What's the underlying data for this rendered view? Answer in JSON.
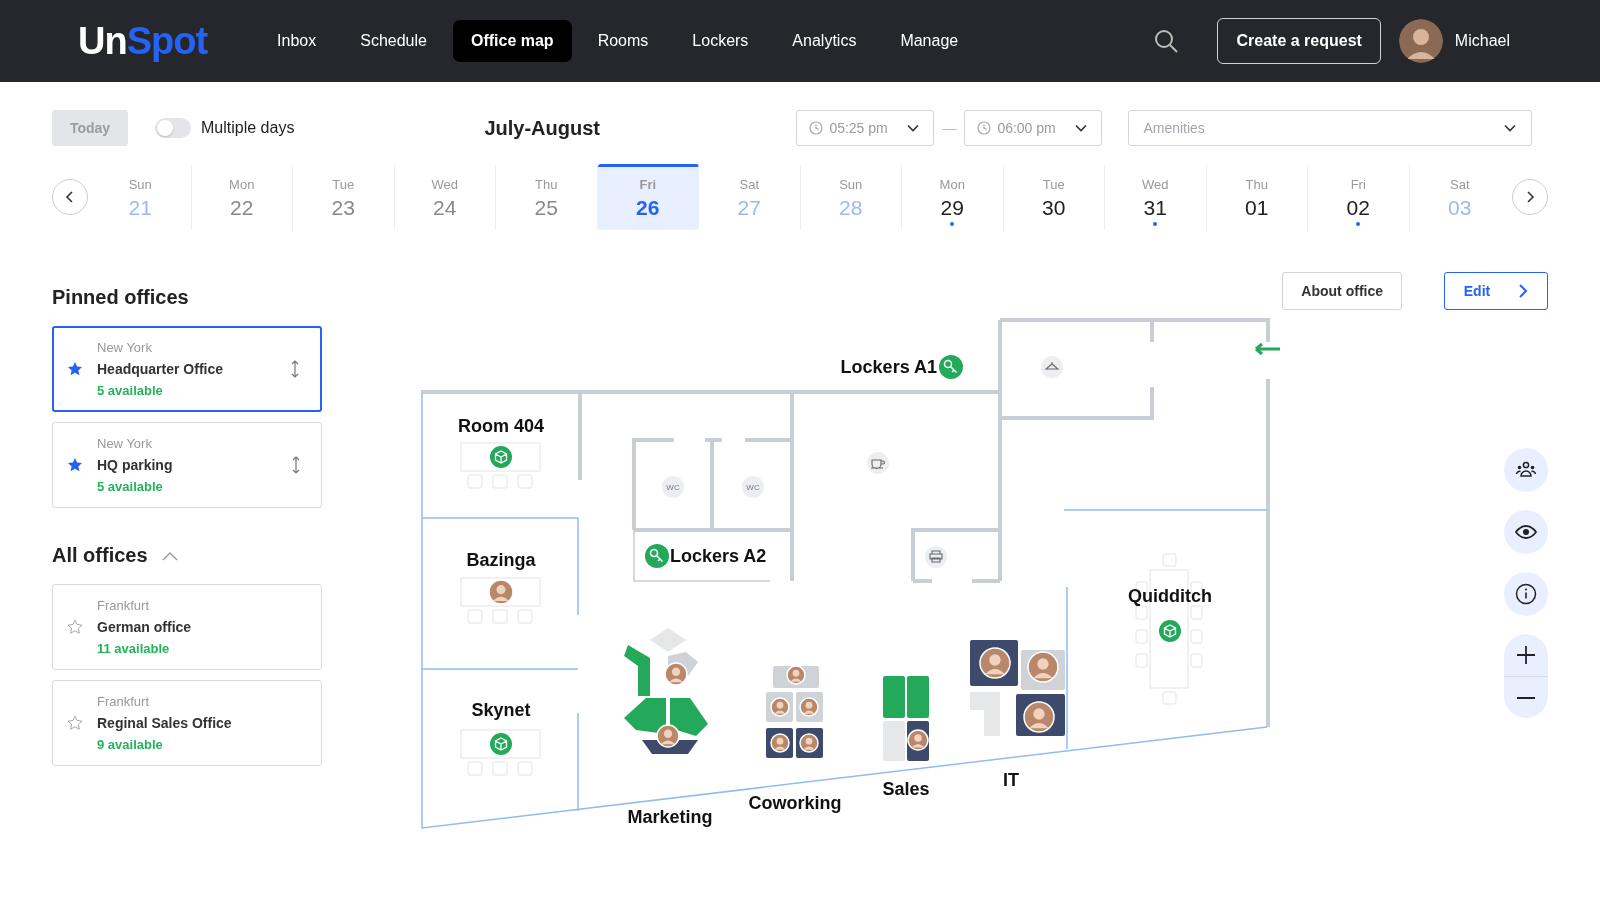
{
  "header": {
    "logo": {
      "text": "Un",
      "accent": "Spot"
    },
    "nav": [
      {
        "label": "Inbox",
        "selected": false
      },
      {
        "label": "Schedule",
        "selected": false
      },
      {
        "label": "Office map",
        "selected": true
      },
      {
        "label": "Rooms",
        "selected": false
      },
      {
        "label": "Lockers",
        "selected": false
      },
      {
        "label": "Analytics",
        "selected": false
      },
      {
        "label": "Manage",
        "selected": false
      }
    ],
    "create_button": "Create a request",
    "user": {
      "name": "Michael"
    }
  },
  "toolbar": {
    "today": "Today",
    "multiple_days": {
      "label": "Multiple days",
      "on": false
    },
    "period": "July-August",
    "time_from": "05:25 pm",
    "separator": "—",
    "time_to": "06:00 pm",
    "amenities": {
      "placeholder": "Amenities"
    }
  },
  "days": [
    {
      "weekday": "Sun",
      "date": "21",
      "kind": "weekend",
      "selected": false,
      "booked": false
    },
    {
      "weekday": "Mon",
      "date": "22",
      "kind": "past",
      "selected": false,
      "booked": false
    },
    {
      "weekday": "Tue",
      "date": "23",
      "kind": "past",
      "selected": false,
      "booked": false
    },
    {
      "weekday": "Wed",
      "date": "24",
      "kind": "past",
      "selected": false,
      "booked": false
    },
    {
      "weekday": "Thu",
      "date": "25",
      "kind": "past",
      "selected": false,
      "booked": false
    },
    {
      "weekday": "Fri",
      "date": "26",
      "kind": "today",
      "selected": true,
      "booked": false
    },
    {
      "weekday": "Sat",
      "date": "27",
      "kind": "weekend",
      "selected": false,
      "booked": false
    },
    {
      "weekday": "Sun",
      "date": "28",
      "kind": "weekend",
      "selected": false,
      "booked": false
    },
    {
      "weekday": "Mon",
      "date": "29",
      "kind": "upcoming",
      "selected": false,
      "booked": true
    },
    {
      "weekday": "Tue",
      "date": "30",
      "kind": "upcoming",
      "selected": false,
      "booked": false
    },
    {
      "weekday": "Wed",
      "date": "31",
      "kind": "upcoming",
      "selected": false,
      "booked": true
    },
    {
      "weekday": "Thu",
      "date": "01",
      "kind": "upcoming",
      "selected": false,
      "booked": false
    },
    {
      "weekday": "Fri",
      "date": "02",
      "kind": "upcoming",
      "selected": false,
      "booked": true
    },
    {
      "weekday": "Sat",
      "date": "03",
      "kind": "weekend",
      "selected": false,
      "booked": false
    }
  ],
  "pinned": {
    "title": "Pinned offices",
    "offices": [
      {
        "city": "New York",
        "name": "Headquarter Office",
        "availability": "5 available",
        "pinned": true,
        "selected": true
      },
      {
        "city": "New York",
        "name": "HQ parking",
        "availability": "5 available",
        "pinned": true,
        "selected": false
      }
    ]
  },
  "all": {
    "title": "All offices",
    "expanded": true,
    "offices": [
      {
        "city": "Frankfurt",
        "name": "German office",
        "availability": "11 available",
        "pinned": false,
        "selected": false
      },
      {
        "city": "Frankfurt",
        "name": "Reginal Sales Office",
        "availability": "9 available",
        "pinned": false,
        "selected": false
      }
    ]
  },
  "office_actions": {
    "about": "About office",
    "edit": "Edit"
  },
  "map": {
    "rooms": [
      {
        "name": "Room 404",
        "booked": false
      },
      {
        "name": "Bazinga",
        "booked": true
      },
      {
        "name": "Skynet",
        "booked": false
      },
      {
        "name": "Quidditch",
        "booked": false
      }
    ],
    "lockers": [
      "Lockers A1",
      "Lockers A2"
    ],
    "restrooms": [
      "WC",
      "WC"
    ],
    "zones": [
      "Marketing",
      "Coworking",
      "Sales",
      "IT"
    ]
  }
}
